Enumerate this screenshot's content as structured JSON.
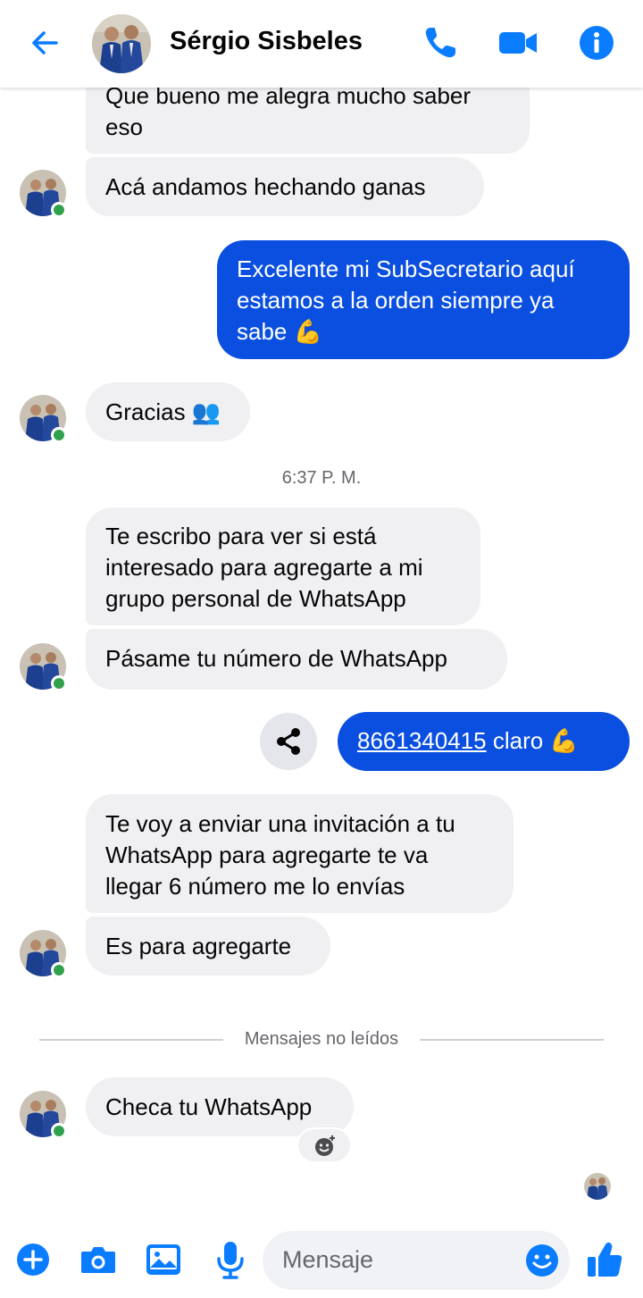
{
  "header": {
    "contact_name": "Sérgio Sisbeles",
    "icons": [
      "back-arrow-icon",
      "phone-icon",
      "video-camera-icon",
      "info-icon"
    ]
  },
  "messages": {
    "m1": [
      "Que bueno me alegra mucho saber",
      "eso"
    ],
    "m2": "Acá andamos hechando ganas",
    "m3": [
      "Excelente mi SubSecretario aquí",
      "estamos a la orden siempre ya",
      "sabe 💪"
    ],
    "m4": "Gracias 👥",
    "timestamp": "6:37 P. M.",
    "m5": [
      "Te escribo para ver si está",
      "interesado para agregarte a mi",
      "grupo personal de WhatsApp"
    ],
    "m6": "Pásame tu número de WhatsApp",
    "m7_link": "8661340415",
    "m7_rest": " claro 💪",
    "m8": [
      "Te voy a enviar una invitación a tu",
      "WhatsApp para agregarte te va",
      "llegar 6 número me lo envías"
    ],
    "m9": "Es para agregarte",
    "unread_divider": "Mensajes no leídos",
    "m10": "Checa tu WhatsApp"
  },
  "composer": {
    "placeholder": "Mensaje",
    "icons": [
      "plus-icon",
      "camera-icon",
      "gallery-icon",
      "microphone-icon",
      "emoji-icon",
      "thumbs-up-icon"
    ]
  },
  "colors": {
    "accent": "#0a7cff",
    "outgoing_bubble": "#0a4fe0",
    "incoming_bubble": "#f0f0f3",
    "online": "#31a24c"
  }
}
